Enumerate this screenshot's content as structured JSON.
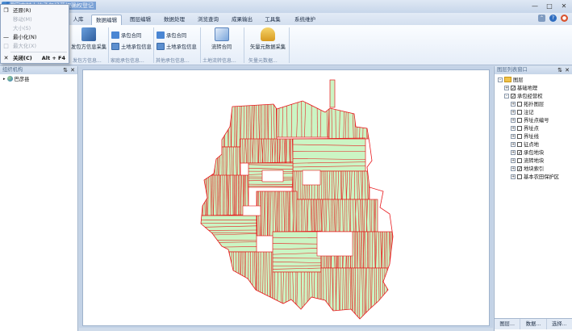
{
  "window": {
    "title": "国家农村土地承包经营权确权登记",
    "controls": [
      "minimize",
      "maximize",
      "close"
    ]
  },
  "ribbon_tabs": [
    {
      "label": "人库",
      "active": false
    },
    {
      "label": "数据编辑",
      "active": true
    },
    {
      "label": "图层编辑",
      "active": false
    },
    {
      "label": "数据处理",
      "active": false
    },
    {
      "label": "浏览查询",
      "active": false
    },
    {
      "label": "成果输出",
      "active": false
    },
    {
      "label": "工具集",
      "active": false
    },
    {
      "label": "系统维护",
      "active": false
    }
  ],
  "ribbon": {
    "group1": {
      "button": "发包方信息采集",
      "label": "发包方信息..."
    },
    "group2": {
      "buttons": [
        "承包合同",
        "土地承包信息"
      ],
      "label": "家庭承包信息..."
    },
    "group3": {
      "buttons": [
        "承包合同",
        "土地承包信息"
      ],
      "label": "其他承包信息..."
    },
    "group4": {
      "button": "流转合同",
      "label": "土地流转信息..."
    },
    "group5": {
      "button": "矢量元数据采集",
      "label": "矢量元数据..."
    }
  },
  "context_menu": {
    "items": [
      {
        "label": "还原(R)",
        "enabled": true,
        "icon": "restore-icon"
      },
      {
        "label": "移动(M)",
        "enabled": false
      },
      {
        "label": "大小(S)",
        "enabled": false
      },
      {
        "label": "最小化(N)",
        "enabled": true,
        "icon": "minimize-icon"
      },
      {
        "label": "最大化(X)",
        "enabled": false,
        "icon": "maximize-icon"
      },
      {
        "label": "关闭(C)",
        "enabled": true,
        "bold": true,
        "shortcut": "Alt + F4",
        "icon": "close-icon"
      }
    ]
  },
  "left_panel": {
    "title": "组织机构",
    "tree": [
      {
        "label": "巴彦县"
      }
    ]
  },
  "right_panel": {
    "title": "图层列表窗口",
    "root": "图层",
    "groups": [
      {
        "label": "基础地理",
        "checked": true
      },
      {
        "label": "承包经营权",
        "checked": true
      }
    ],
    "layers": [
      {
        "label": "拓扑图层",
        "checked": false
      },
      {
        "label": "注记",
        "checked": false
      },
      {
        "label": "界址点编号",
        "checked": false
      },
      {
        "label": "界址点",
        "checked": false
      },
      {
        "label": "界址线",
        "checked": false
      },
      {
        "label": "征点地",
        "checked": false
      },
      {
        "label": "承包地块",
        "checked": true
      },
      {
        "label": "流转地块",
        "checked": false
      },
      {
        "label": "地块索引",
        "checked": true
      },
      {
        "label": "基本农田保护区",
        "checked": false
      }
    ],
    "bottom_tabs": [
      "图层...",
      "数据...",
      "选择..."
    ]
  },
  "colors": {
    "parcel_fill": "#cbf5c4",
    "parcel_stroke": "#e8181c",
    "ribbon_bg": "#eef3fa",
    "accent": "#2f6dc0"
  }
}
